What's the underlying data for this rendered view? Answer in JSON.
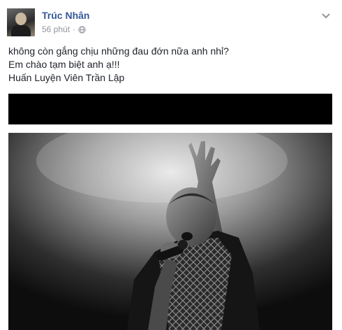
{
  "post": {
    "author": "Trúc Nhân",
    "time": "56 phút",
    "separator": "·",
    "privacy_icon": "globe-icon",
    "options_icon": "chevron-down-icon",
    "lines": [
      "không còn gắng chịu những đau đớn nữa anh nhỉ?",
      "Em chào tạm biệt anh ạ!!!",
      "Huấn Luyện Viên Trần Lập"
    ]
  },
  "colors": {
    "author_link": "#365899",
    "meta_gray": "#90949c",
    "text": "#1d2129",
    "background": "#ffffff"
  }
}
